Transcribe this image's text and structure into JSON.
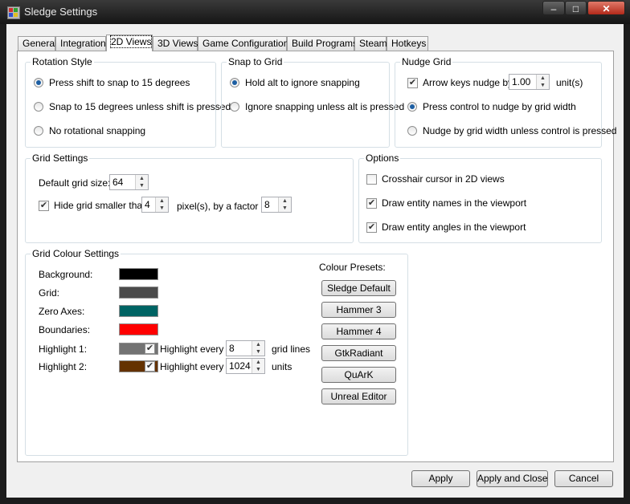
{
  "window": {
    "title": "Sledge Settings",
    "min_glyph": "–",
    "max_glyph": "□",
    "close_glyph": "✕"
  },
  "tabs": [
    {
      "label": "General"
    },
    {
      "label": "Integration"
    },
    {
      "label": "2D Views"
    },
    {
      "label": "3D Views"
    },
    {
      "label": "Game Configurations"
    },
    {
      "label": "Build Programs"
    },
    {
      "label": "Steam"
    },
    {
      "label": "Hotkeys"
    }
  ],
  "selected_tab": "2D Views",
  "rotation_style": {
    "title": "Rotation Style",
    "options": [
      {
        "label": "Press shift to snap to 15 degrees",
        "selected": true
      },
      {
        "label": "Snap to 15 degrees unless shift is pressed",
        "selected": false
      },
      {
        "label": "No rotational snapping",
        "selected": false
      }
    ]
  },
  "snap_to_grid": {
    "title": "Snap to Grid",
    "options": [
      {
        "label": "Hold alt to ignore snapping",
        "selected": true
      },
      {
        "label": "Ignore snapping unless alt is pressed",
        "selected": false
      }
    ]
  },
  "nudge_grid": {
    "title": "Nudge Grid",
    "arrow_keys_label": "Arrow keys nudge by",
    "arrow_keys_checked": true,
    "nudge_value": "1.00",
    "unit_label": "unit(s)",
    "options": [
      {
        "label": "Press control to nudge by grid width",
        "selected": true
      },
      {
        "label": "Nudge by grid width unless control is pressed",
        "selected": false
      }
    ]
  },
  "grid_settings": {
    "title": "Grid Settings",
    "default_grid_label": "Default grid size:",
    "default_grid_value": "64",
    "hide_grid_label": "Hide grid smaller than",
    "hide_grid_checked": true,
    "hide_grid_value": "4",
    "factor_label": "pixel(s), by a factor of",
    "factor_value": "8"
  },
  "options": {
    "title": "Options",
    "items": [
      {
        "label": "Crosshair cursor in 2D views",
        "checked": false
      },
      {
        "label": "Draw entity names in the viewport",
        "checked": true
      },
      {
        "label": "Draw entity angles in the viewport",
        "checked": true
      }
    ]
  },
  "grid_colours": {
    "title": "Grid Colour Settings",
    "rows": [
      {
        "label": "Background:",
        "color": "#000000"
      },
      {
        "label": "Grid:",
        "color": "#4b4b4b"
      },
      {
        "label": "Zero Axes:",
        "color": "#006464"
      },
      {
        "label": "Boundaries:",
        "color": "#ff0000"
      },
      {
        "label": "Highlight 1:",
        "color": "#737373"
      },
      {
        "label": "Highlight 2:",
        "color": "#643200"
      }
    ],
    "highlight1": {
      "checkbox_label": "Highlight every",
      "checked": true,
      "value": "8",
      "suffix": "grid lines"
    },
    "highlight2": {
      "checkbox_label": "Highlight every",
      "checked": true,
      "value": "1024",
      "suffix": "units"
    },
    "presets_label": "Colour Presets:",
    "presets": [
      "Sledge Default",
      "Hammer 3",
      "Hammer 4",
      "GtkRadiant",
      "QuArK",
      "Unreal Editor"
    ]
  },
  "footer": {
    "apply": "Apply",
    "apply_close": "Apply and Close",
    "cancel": "Cancel"
  },
  "glyphs": {
    "check": "✔",
    "up": "▲",
    "down": "▼"
  }
}
